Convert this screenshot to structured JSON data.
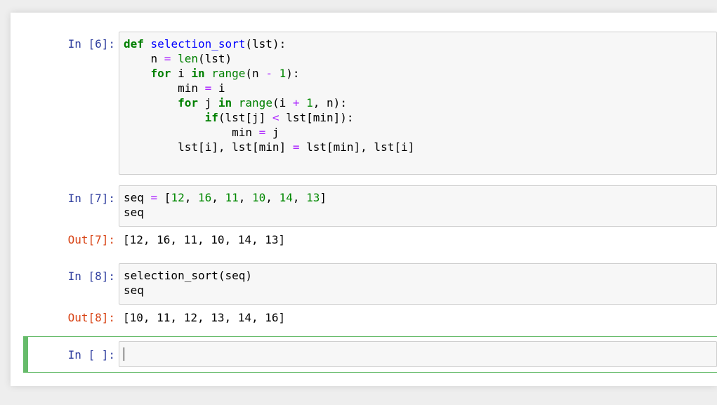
{
  "cells": {
    "c6": {
      "prompt": "In [6]:",
      "lines": {
        "l1": {
          "def": "def",
          "name": "selection_sort",
          "args": "(lst):"
        },
        "l2": {
          "indent": "    ",
          "a": "n ",
          "eq": "=",
          "sp": " ",
          "len": "len",
          "rest": "(lst)"
        },
        "l3": {
          "indent": "    ",
          "for": "for",
          "a": " i ",
          "in": "in",
          "sp": " ",
          "range": "range",
          "b": "(n ",
          "minus": "-",
          "sp2": " ",
          "one": "1",
          "c": "):"
        },
        "l4": {
          "indent": "        ",
          "a": "min ",
          "eq": "=",
          "b": " i"
        },
        "l5": {
          "indent": "        ",
          "for": "for",
          "a": " j ",
          "in": "in",
          "sp": " ",
          "range": "range",
          "b": "(i ",
          "plus": "+",
          "sp2": " ",
          "one": "1",
          "c": ", n):"
        },
        "l6": {
          "indent": "            ",
          "if": "if",
          "a": "(lst[j] ",
          "lt": "<",
          "b": " lst[min]):"
        },
        "l7": {
          "indent": "                ",
          "a": "min ",
          "eq": "=",
          "b": " j"
        },
        "l8": {
          "indent": "        ",
          "a": "lst[i], lst[min] ",
          "eq": "=",
          "b": " lst[min], lst[i]"
        }
      }
    },
    "c7": {
      "prompt": "In [7]:",
      "l1": {
        "a": "seq ",
        "eq": "=",
        "b": " [",
        "n1": "12",
        "s1": ", ",
        "n2": "16",
        "s2": ", ",
        "n3": "11",
        "s3": ", ",
        "n4": "10",
        "s4": ", ",
        "n5": "14",
        "s5": ", ",
        "n6": "13",
        "c": "]"
      },
      "l2": "seq",
      "out_prompt": "Out[7]:",
      "output": "[12, 16, 11, 10, 14, 13]"
    },
    "c8": {
      "prompt": "In [8]:",
      "l1": "selection_sort(seq)",
      "l2": "seq",
      "out_prompt": "Out[8]:",
      "output": "[10, 11, 12, 13, 14, 16]"
    },
    "c9": {
      "prompt": "In [ ]:",
      "value": ""
    }
  },
  "colors": {
    "keyword": "#008000",
    "function_name": "#0000ff",
    "number": "#008800",
    "operator": "#aa22ff",
    "in_prompt": "#303f9f",
    "out_prompt": "#d84315",
    "selected_cell": "#66bb6a"
  }
}
